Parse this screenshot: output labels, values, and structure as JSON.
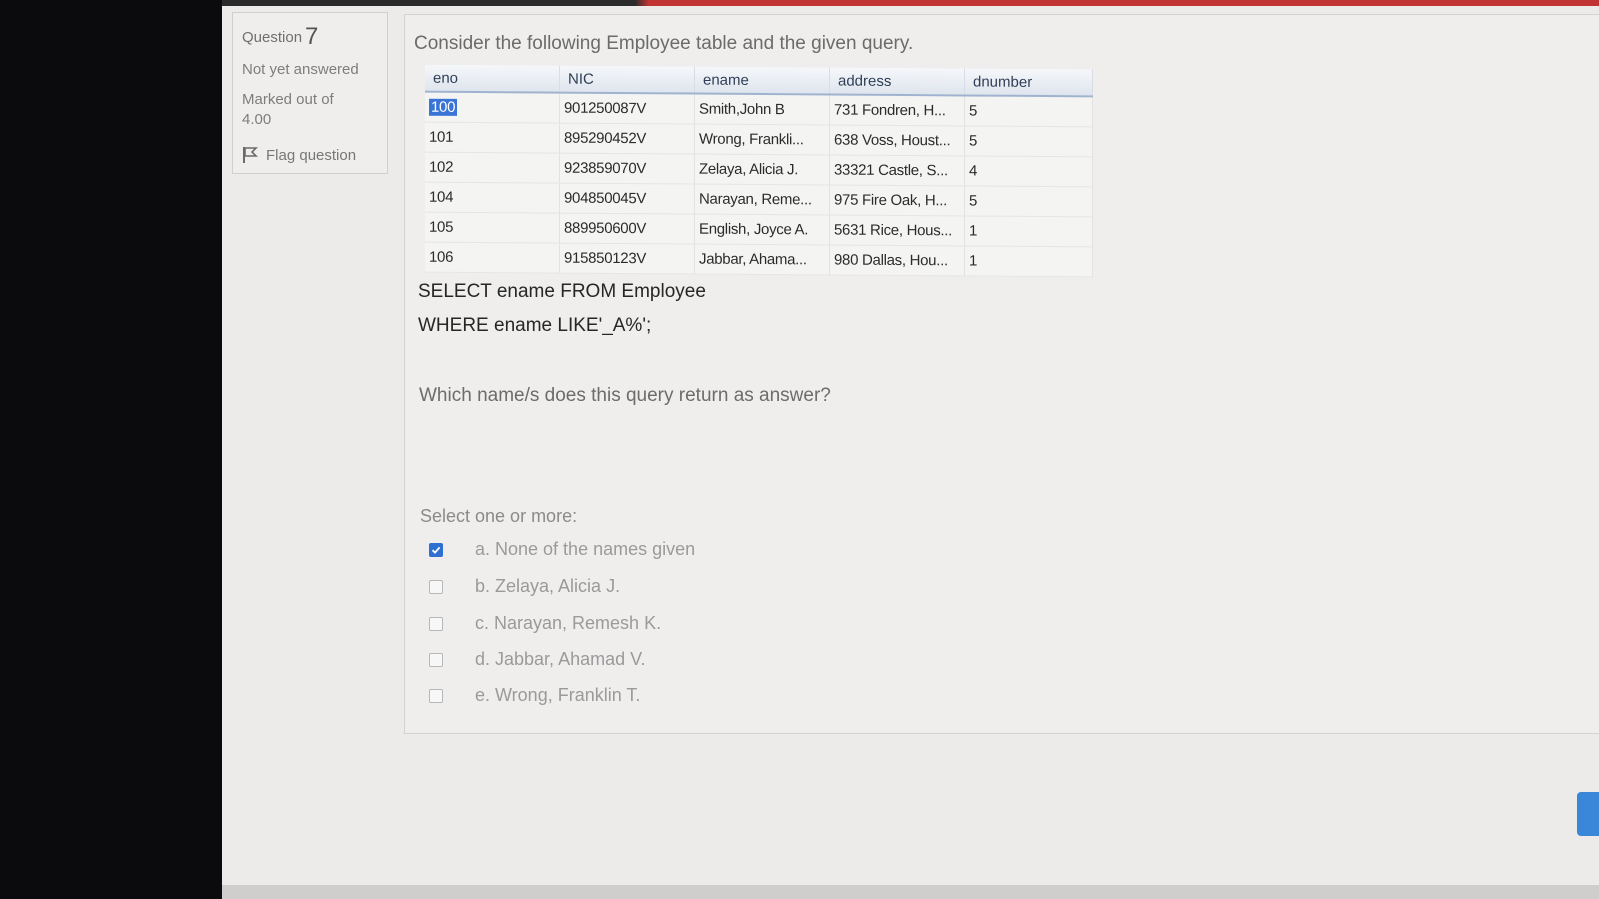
{
  "question": {
    "label": "Question",
    "number": "7",
    "status": "Not yet answered",
    "marked_label": "Marked out of",
    "marked_value": "4.00",
    "flag_label": "Flag question"
  },
  "content": {
    "intro": "Consider the following Employee table and the given query.",
    "table": {
      "headers": [
        "eno",
        "NIC",
        "ename",
        "address",
        "dnumber"
      ],
      "rows": [
        [
          "100",
          "901250087V",
          "Smith,John B",
          "731 Fondren, H...",
          "5"
        ],
        [
          "101",
          "895290452V",
          "Wrong, Frankli...",
          "638 Voss, Houst...",
          "5"
        ],
        [
          "102",
          "923859070V",
          "Zelaya, Alicia J.",
          "33321 Castle, S...",
          "4"
        ],
        [
          "104",
          "904850045V",
          "Narayan, Reme...",
          "975 Fire Oak, H...",
          "5"
        ],
        [
          "105",
          "889950600V",
          "English, Joyce A.",
          "5631 Rice, Hous...",
          "1"
        ],
        [
          "106",
          "915850123V",
          "Jabbar, Ahama...",
          "980 Dallas, Hou...",
          "1"
        ]
      ]
    },
    "sql_line1": "SELECT ename FROM Employee",
    "sql_line2": "WHERE ename LIKE'_A%';",
    "prompt": "Which name/s does this query return as answer?",
    "select_hint": "Select one or more:",
    "options": [
      {
        "label": "a. None of the names given",
        "checked": true
      },
      {
        "label": "b. Zelaya, Alicia J.",
        "checked": false
      },
      {
        "label": "c. Narayan, Remesh K.",
        "checked": false
      },
      {
        "label": "d. Jabbar, Ahamad V.",
        "checked": false
      },
      {
        "label": "e. Wrong, Franklin T.",
        "checked": false
      }
    ]
  }
}
